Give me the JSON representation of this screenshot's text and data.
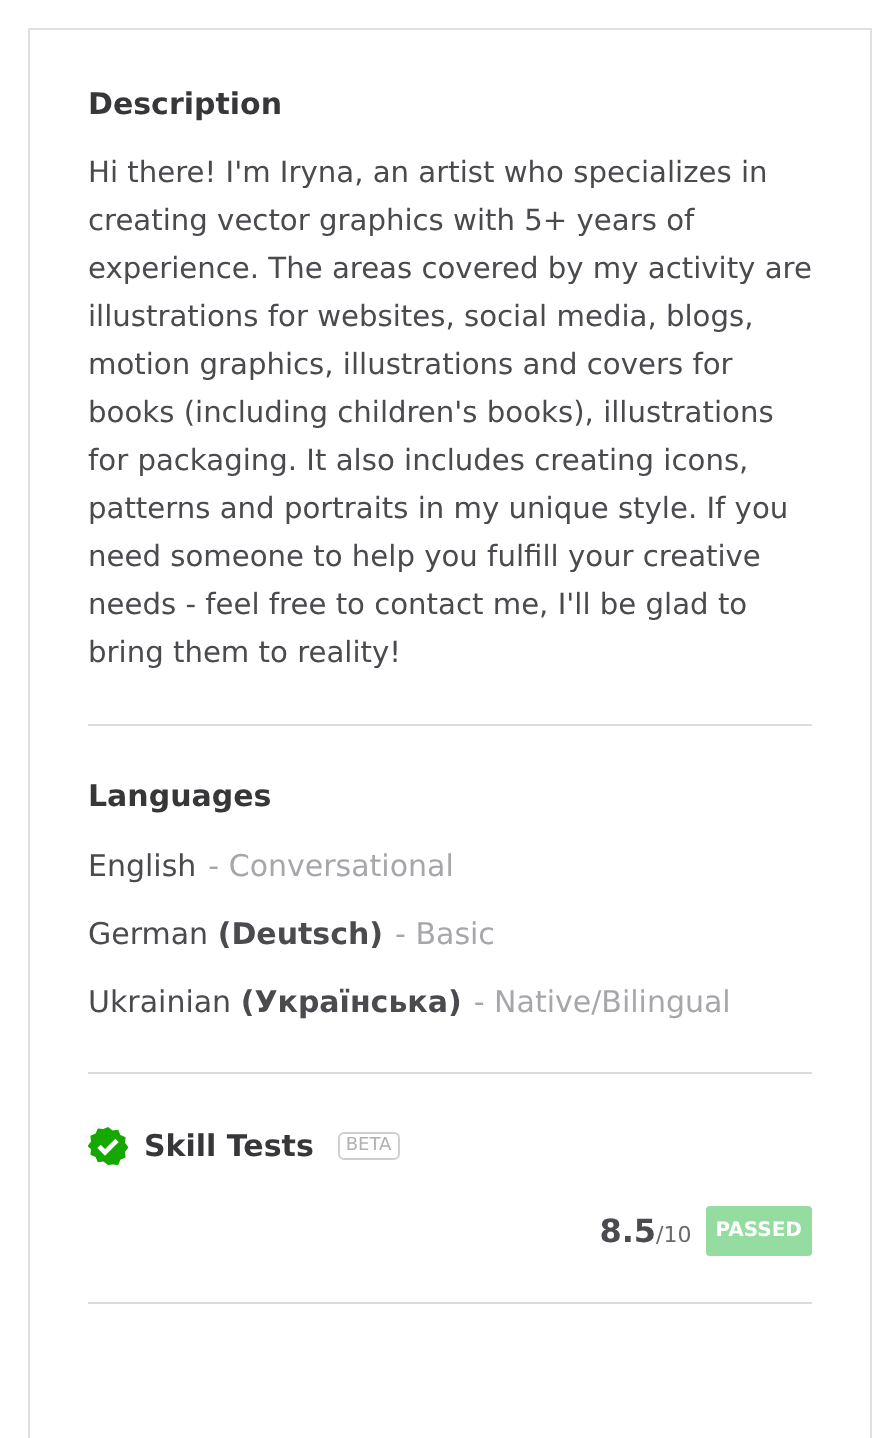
{
  "description": {
    "title": "Description",
    "text": "Hi there! I'm Iryna, an artist who specializes in creating vector graphics with 5+ years of experience. The areas covered by my activity are illustrations for websites, social media, blogs, motion graphics, illustrations and covers for books (including children's books), illustrations for packaging. It also includes creating icons, patterns and portraits in my unique style. If you need someone to help you fulfill your creative needs - feel free to contact me, I'll be glad to bring them to reality!"
  },
  "languages": {
    "title": "Languages",
    "items": [
      {
        "name": "English",
        "level": "- Conversational"
      },
      {
        "name": "German **(Deutsch)**",
        "level": "- Basic"
      },
      {
        "name": "Ukrainian **(Українська)**",
        "level": "- Native/Bilingual"
      }
    ]
  },
  "skill_tests": {
    "title": "Skill Tests",
    "badge": "BETA",
    "score": "8.5",
    "out_of": "/10",
    "status": "PASSED"
  }
}
